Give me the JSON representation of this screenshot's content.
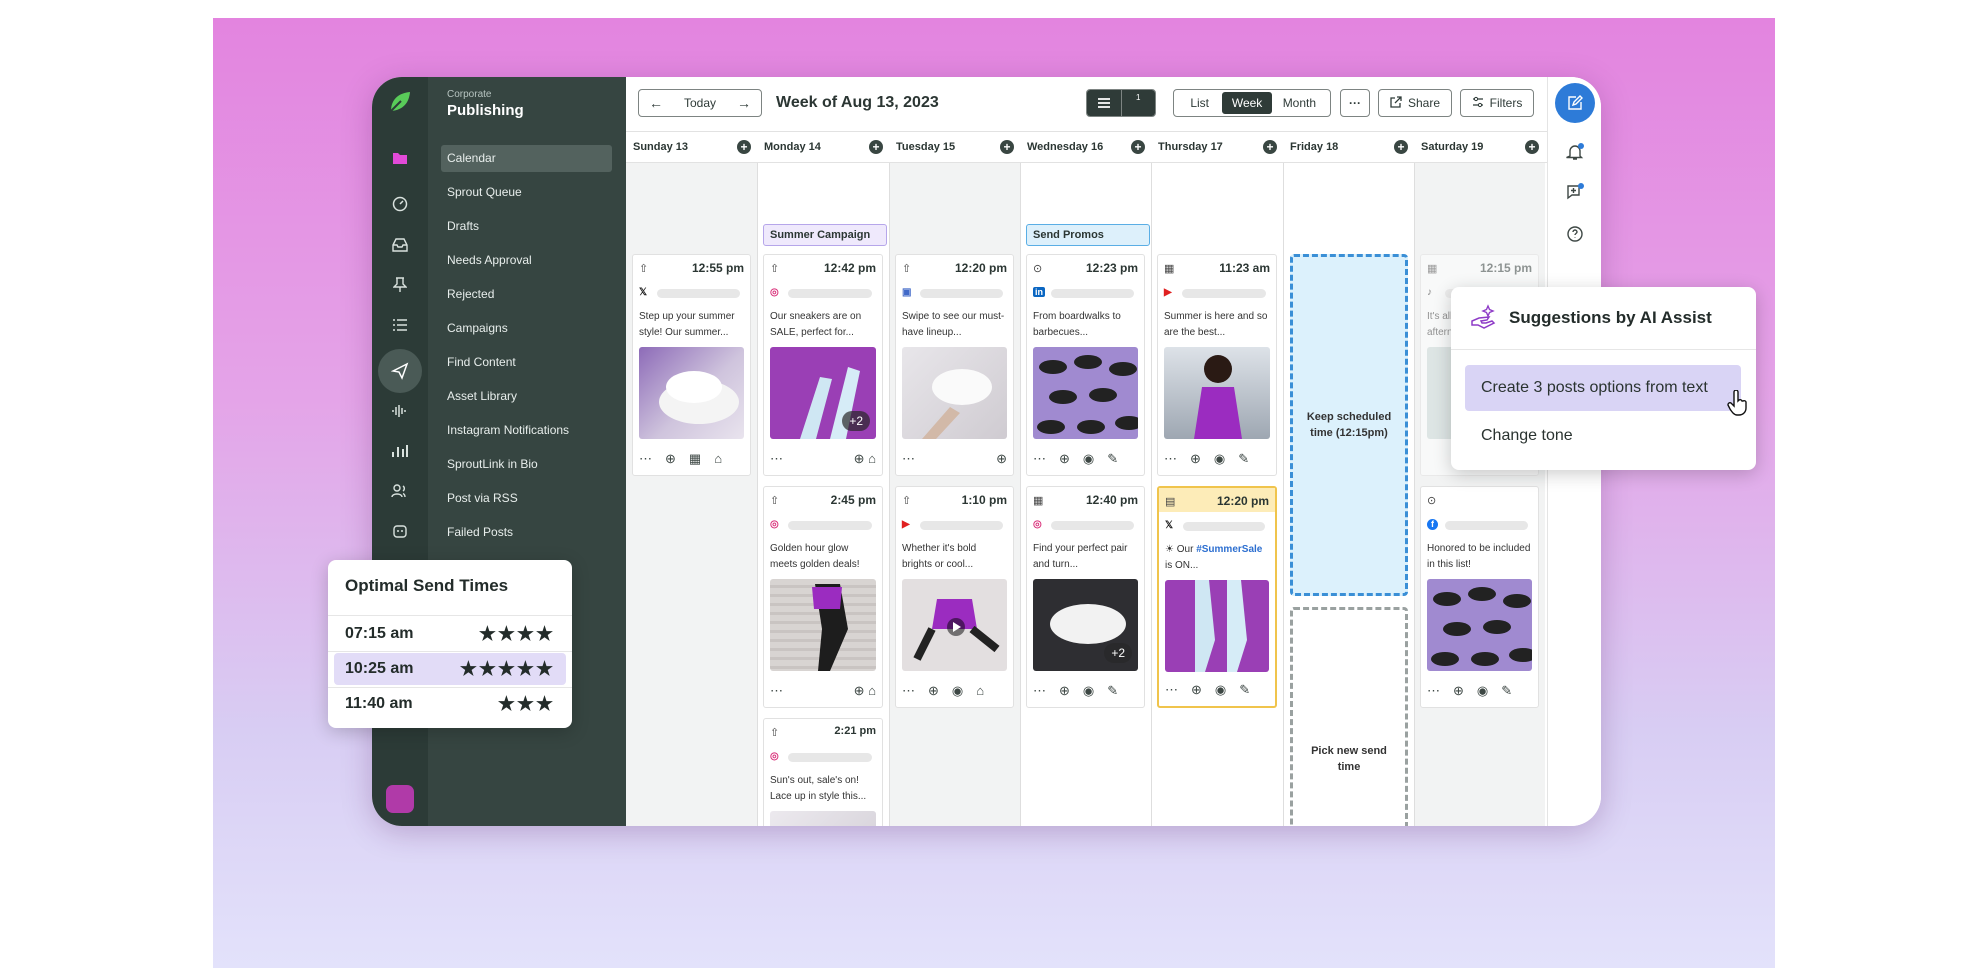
{
  "brand": {
    "subtitle": "Corporate",
    "title": "Publishing"
  },
  "sidebar": {
    "items": [
      "Calendar",
      "Sprout Queue",
      "Drafts",
      "Needs Approval",
      "Rejected",
      "Campaigns",
      "Find Content",
      "Asset Library",
      "Instagram Notifications",
      "SproutLink in Bio",
      "Post via RSS",
      "Failed Posts"
    ]
  },
  "toolbar": {
    "today_label": "Today",
    "week_title": "Week of Aug 13, 2023",
    "badge_count": "1",
    "view_list": "List",
    "view_week": "Week",
    "view_month": "Month",
    "more_label": "···",
    "share_label": "Share",
    "filters_label": "Filters"
  },
  "days": [
    "Sunday 13",
    "Monday 14",
    "Tuesday 15",
    "Wednesday 16",
    "Thursday 17",
    "Friday 18",
    "Saturday 19"
  ],
  "campaigns": {
    "summer": "Summer Campaign",
    "promos": "Send Promos"
  },
  "posts": [
    {
      "time": "12:55 pm",
      "net": "𝕏",
      "text": "Step up your summer style! Our summer...",
      "plus": ""
    },
    {
      "time": "12:42 pm",
      "net": "◎",
      "text": "Our sneakers are on SALE, perfect for...",
      "plus": "+2"
    },
    {
      "time": "12:20 pm",
      "net": "▣",
      "text": "Swipe to see our must-have lineup...",
      "plus": ""
    },
    {
      "time": "12:23 pm",
      "net": "in",
      "text": "From boardwalks to barbecues...",
      "plus": ""
    },
    {
      "time": "11:23 am",
      "net": "▶",
      "text": "Summer is here and so are the best...",
      "plus": ""
    },
    {
      "time": "12:15 pm",
      "net": "♪",
      "text": "It's all about that afternoon coffee swirl!",
      "plus": ""
    },
    {
      "time": "2:45 pm",
      "net": "◎",
      "text": "Golden hour glow meets golden deals!",
      "plus": ""
    },
    {
      "time": "1:10 pm",
      "net": "▶",
      "text": "Whether it's bold brights or cool...",
      "plus": ""
    },
    {
      "time": "12:40 pm",
      "net": "◎",
      "text": "Find your perfect pair and turn...",
      "plus": "+2"
    },
    {
      "time": "12:20 pm",
      "net": "𝕏",
      "text_a": "☀ Our ",
      "text_b": "#SummerSale",
      "text_c": " is ON...",
      "plus": ""
    },
    {
      "time": "",
      "net": "f",
      "text": "Honored to be included in this list!",
      "plus": ""
    },
    {
      "time": "2:21 pm",
      "net": "◎",
      "text": "Sun's out, sale's on! Lace up in style this...",
      "plus": ""
    }
  ],
  "friday": {
    "keep": "Keep scheduled time (12:15pm)",
    "pick": "Pick new send time"
  },
  "optimal": {
    "title": "Optimal Send Times",
    "rows": [
      {
        "time": "07:15 am",
        "stars": "★★★★"
      },
      {
        "time": "10:25 am",
        "stars": "★★★★★"
      },
      {
        "time": "11:40 am",
        "stars": "★★★"
      }
    ]
  },
  "ai": {
    "title": "Suggestions by AI Assist",
    "option1": "Create 3 posts options from text",
    "option2": "Change tone"
  },
  "colors": {
    "accent": "#2d7bd8",
    "brand_green": "#59cb59",
    "rail": "#2c3b37",
    "nav": "#364541",
    "highlight": "#e2dcf7"
  }
}
